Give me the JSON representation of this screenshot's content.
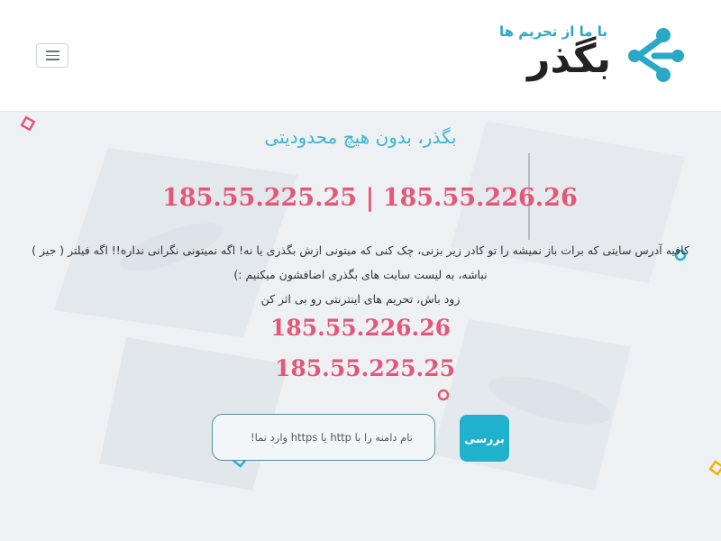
{
  "header": {
    "menu_icon": "hamburger-menu-icon",
    "logo": {
      "tagline": "با ما از تحریم ها",
      "name": "بگذر",
      "icon": "network-nodes-icon"
    }
  },
  "hero": {
    "title": "بگذر، بدون هیچ محدودیتی",
    "main_ips": "185.55.225.25 | 185.55.226.26",
    "description_lines": [
      "کافیه آدرس سایتی که برات باز نمیشه را تو کادر زیر بزنی، چک کنی که میتونی ازش بگذری یا نه! اگه نمیتونی نگرانی نداره!! اگه فیلتر ( جیز )",
      "نباشه، به لیست سایت های بگذری اضافشون میکنیم :)",
      "زود باش، تحریم های اینترنتی رو بی اثر کن"
    ],
    "ip_list": [
      "185.55.226.26",
      "185.55.225.25"
    ]
  },
  "search": {
    "placeholder": "نام دامنه را با http یا https وارد نما!",
    "value": "",
    "button_label": "بررسی"
  },
  "colors": {
    "accent": "#20b1cc",
    "highlight": "#e35779",
    "title": "#3fb3cb",
    "hero_bg": "#eef1f4"
  }
}
